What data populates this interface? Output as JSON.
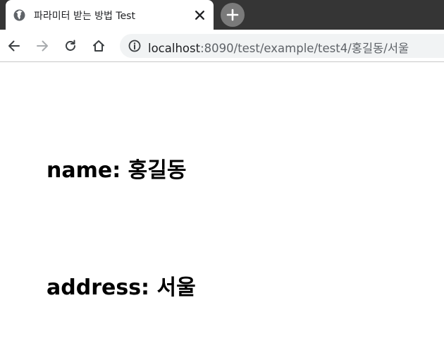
{
  "tab": {
    "title": "파라미터 받는 방법 Test",
    "favicon_icon": "globe-icon",
    "close_icon": "close-icon"
  },
  "new_tab": {
    "icon": "plus-icon"
  },
  "toolbar": {
    "back_icon": "arrow-left-icon",
    "forward_icon": "arrow-right-icon",
    "reload_icon": "reload-icon",
    "home_icon": "home-icon",
    "info_icon": "info-icon"
  },
  "address_bar": {
    "host": "localhost",
    "rest": ":8090/test/example/test4/홍길동/서울"
  },
  "content": {
    "name_label": "name: ",
    "name_value": "홍길동",
    "address_label": "address: ",
    "address_value": "서울"
  },
  "colors": {
    "tab_strip": "#353535",
    "omnibox": "#f1f3f4",
    "text": "#000000"
  }
}
